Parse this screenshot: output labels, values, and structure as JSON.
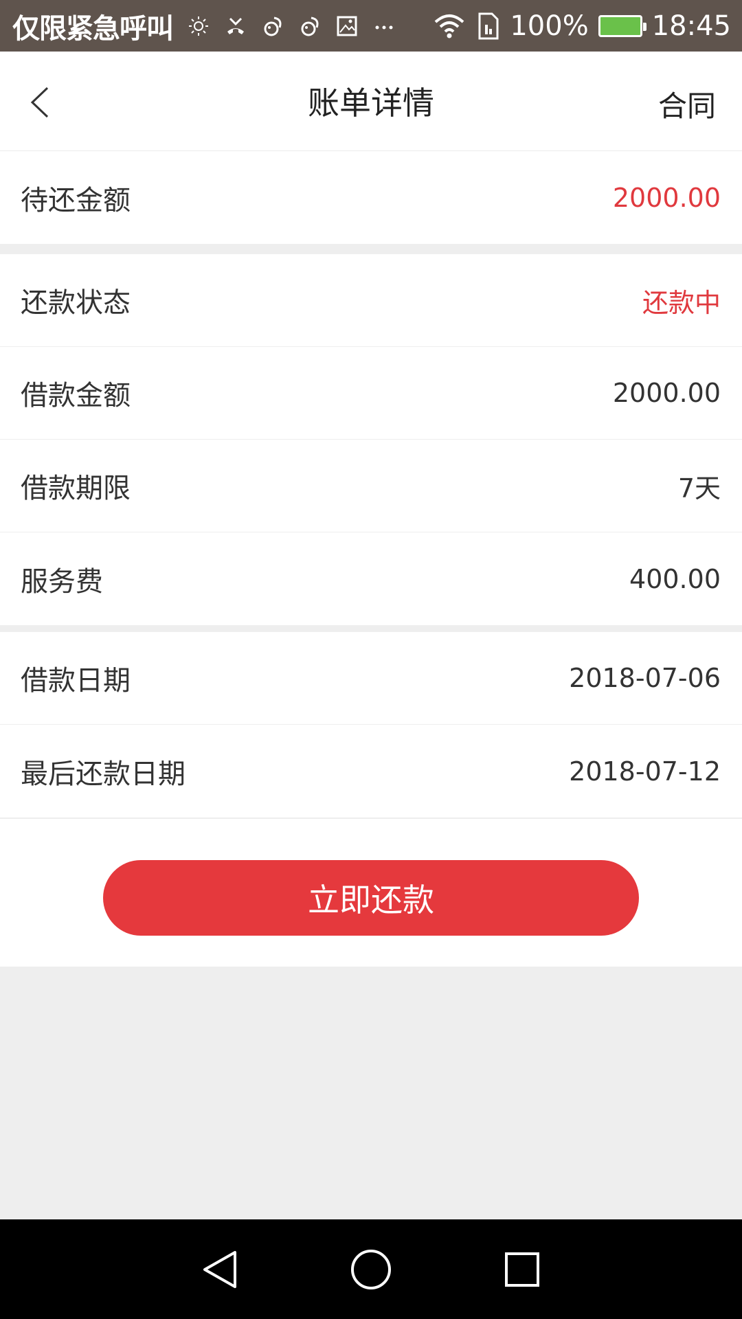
{
  "status_bar": {
    "carrier_text": "仅限紧急呼叫",
    "battery_percent": "100%",
    "time": "18:45",
    "icons": [
      "brightness-icon",
      "missed-call-icon",
      "squirrel-icon",
      "squirrel-icon",
      "image-icon",
      "more-icon",
      "wifi-icon",
      "sim-icon",
      "battery-charging-icon"
    ],
    "background_color": "#5f544d"
  },
  "header": {
    "title": "账单详情",
    "right_link": "合同"
  },
  "pending": {
    "label": "待还金额",
    "value": "2000.00"
  },
  "details": [
    {
      "label": "还款状态",
      "value": "还款中",
      "highlight": true
    },
    {
      "label": "借款金额",
      "value": "2000.00"
    },
    {
      "label": "借款期限",
      "value": "7天"
    },
    {
      "label": "服务费",
      "value": "400.00"
    }
  ],
  "dates": [
    {
      "label": "借款日期",
      "value": "2018-07-06"
    },
    {
      "label": "最后还款日期",
      "value": "2018-07-12"
    }
  ],
  "action": {
    "repay_label": "立即还款",
    "accent_color": "#e5393d"
  },
  "nav": {
    "icons": [
      "back-triangle-icon",
      "home-circle-icon",
      "recents-square-icon"
    ]
  }
}
